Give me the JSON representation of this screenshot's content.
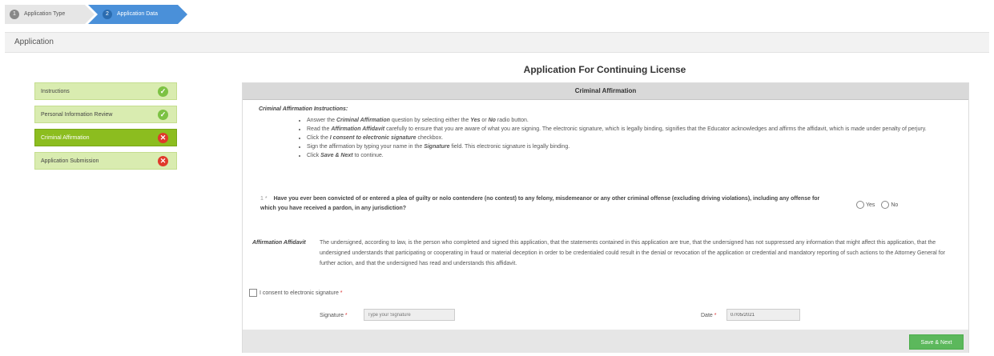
{
  "wizard": {
    "steps": [
      {
        "number": "1",
        "label": "Application Type"
      },
      {
        "number": "2",
        "label": "Application Data"
      }
    ]
  },
  "app_bar": {
    "title": "Application"
  },
  "main_title": "Application For Continuing License",
  "sidebar": {
    "items": [
      {
        "label": "Instructions",
        "status": "complete"
      },
      {
        "label": "Personal Information Review",
        "status": "complete"
      },
      {
        "label": "Criminal Affirmation",
        "status": "incomplete",
        "active": true
      },
      {
        "label": "Application Submission",
        "status": "incomplete"
      }
    ]
  },
  "panel": {
    "header": "Criminal Affirmation",
    "instructions_title": "Criminal Affirmation Instructions:",
    "instructions": [
      {
        "a": "Answer the ",
        "b": "Criminal Affirmation",
        "c": " question by selecting either the ",
        "d": "Yes",
        "e": " or ",
        "f": "No",
        "g": " radio button."
      },
      {
        "a": "Read the ",
        "b": "Affirmation Affidavit",
        "c": " carefully to ensure that you are aware of what you are signing. The electronic signature, which is legally binding, signifies that the Educator acknowledges and affirms the affidavit, which is made under penalty of perjury."
      },
      {
        "a": "Click the ",
        "b": "I consent to electronic signature",
        "c": " checkbox."
      },
      {
        "a": "Sign the affirmation by typing your name in the ",
        "b": "Signature",
        "c": " field. This electronic signature is legally binding."
      },
      {
        "a": "Click ",
        "b": "Save & Next",
        "c": " to continue."
      }
    ],
    "question_marker": "1 *",
    "question": "Have you ever been convicted of or entered a plea of guilty or nolo contendere (no contest) to any felony, misdemeanor or any other criminal offense (excluding driving violations), including any offense for which you have received a pardon, in any jurisdiction?",
    "radio_yes": "Yes",
    "radio_no": "No",
    "affidavit_label": "Affirmation Affidavit",
    "affidavit_text": "The undersigned, according to law, is the person who completed and signed this application, that the statements contained in this application are true, that the undersigned has not suppressed any information that might affect this application, that the undersigned understands that participating or cooperating in fraud or material deception in order to be credentialed could result in the denial or revocation of the application or credential and mandatory reporting of such actions to the Attorney General for further action, and that the undersigned has read and understands this affidavit.",
    "consent_label": "I consent to electronic signature",
    "required_mark": "*",
    "signature_label": "Signature",
    "signature_placeholder": "Type your Signature",
    "date_label": "Date",
    "date_value": "07/05/2021",
    "save_button": "Save & Next"
  },
  "colors": {
    "wizard_active": "#4a90d9",
    "sidebar_complete_bg": "#d9ecb0",
    "sidebar_active_bg": "#8cbd1f",
    "status_ok": "#7cc243",
    "status_err": "#e0392b",
    "save_button": "#5cb85c"
  },
  "icons": {
    "complete": "check-circle-icon",
    "incomplete": "x-circle-icon"
  }
}
